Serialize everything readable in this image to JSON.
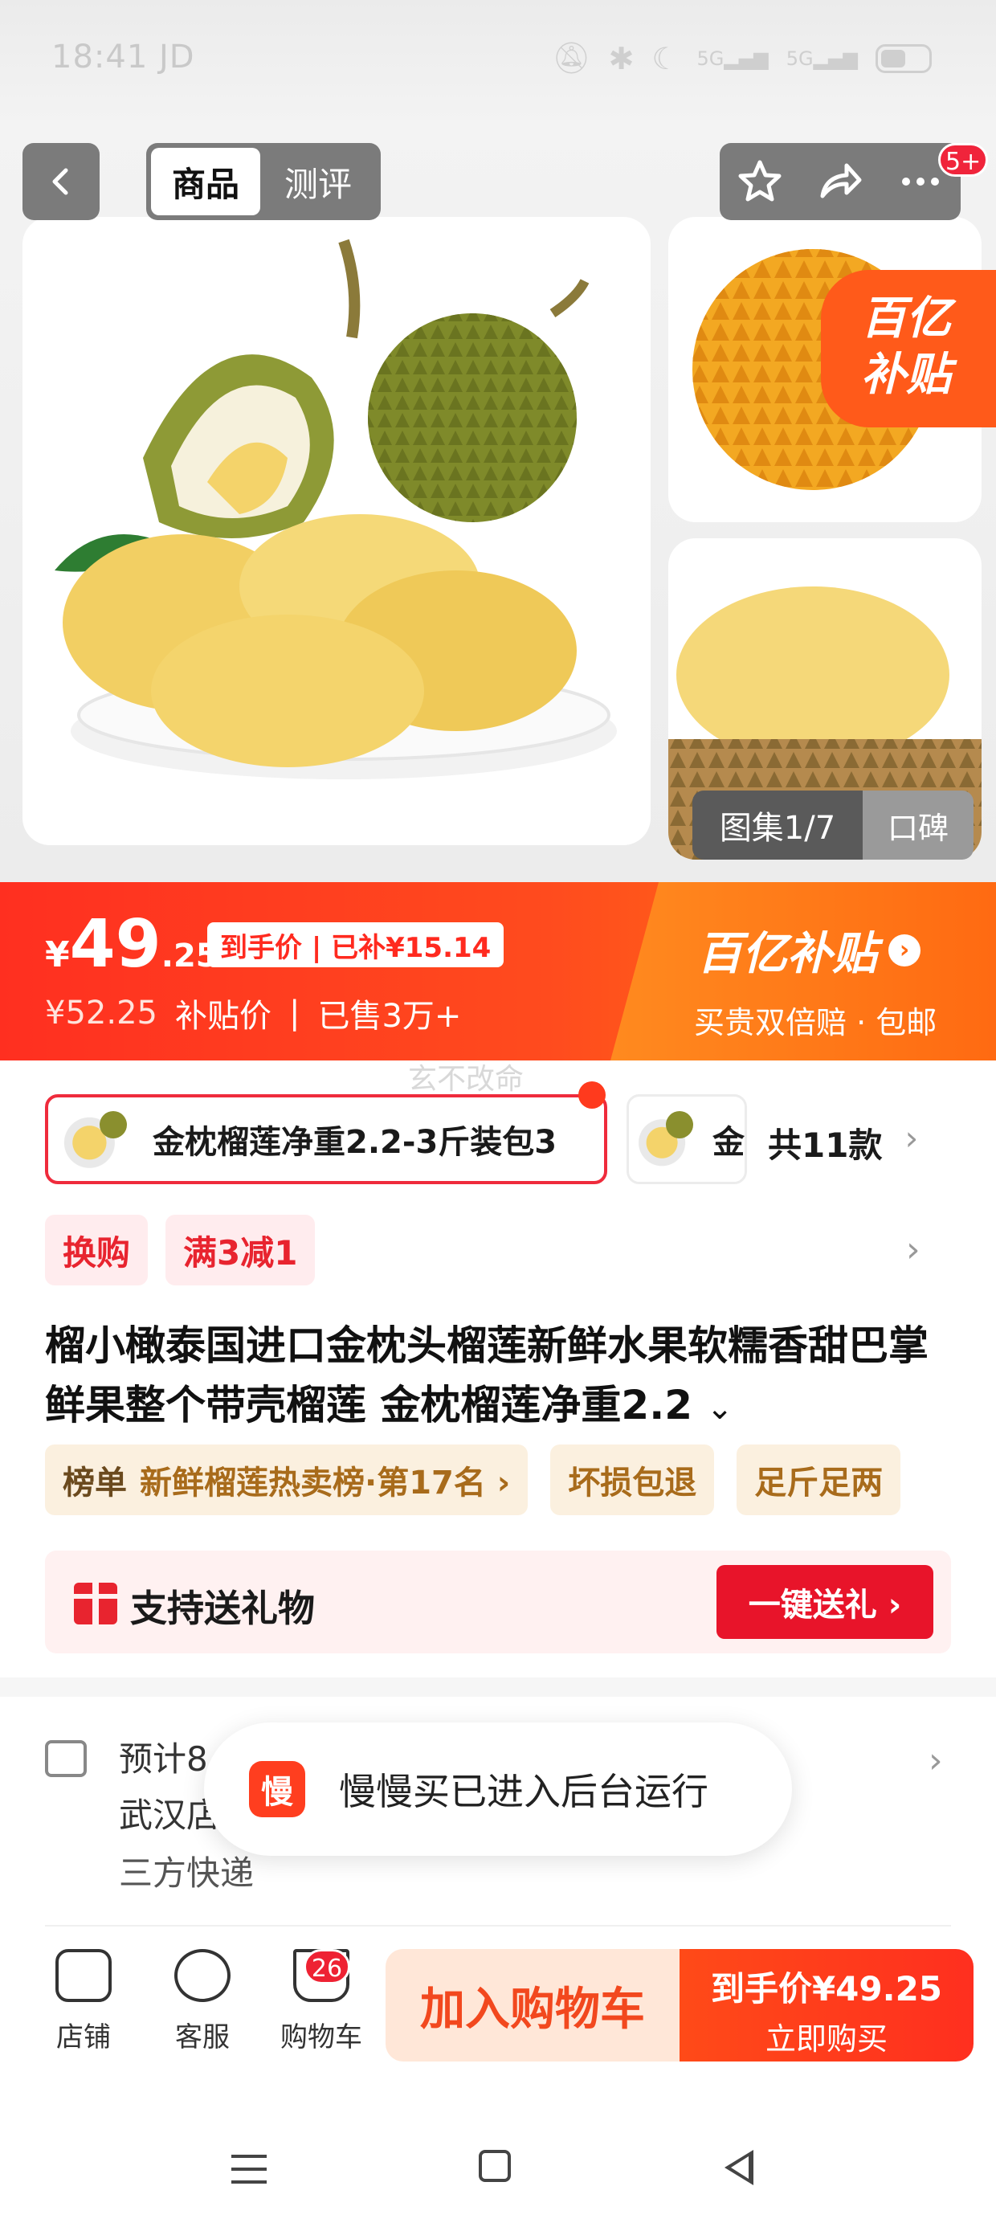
{
  "status_bar": {
    "time": "18:41",
    "carrier": "JD",
    "signal_1": "5G",
    "signal_2": "5G"
  },
  "nav": {
    "tab_goods": "商品",
    "tab_review": "测评",
    "notif_badge": "5+"
  },
  "gallery": {
    "subsidy_tag_l1": "百亿",
    "subsidy_tag_l2": "补贴",
    "album_counter": "图集1/7",
    "reputation_tab": "口碑"
  },
  "price": {
    "currency": "¥",
    "integer": "49",
    "decimal": ".25",
    "arrive_label": "到手价 | 已补¥15.14",
    "original": "¥52.25",
    "subsidy_label": "补贴价",
    "sold": "已售3万+",
    "brand": "百亿补贴",
    "brand_sub": "买贵双倍赔 · 包邮",
    "brand_arrow": "›"
  },
  "watermark": "玄不改命",
  "variants": {
    "selected_label": "金枕榴莲净重2.2-3斤装包3",
    "next_label_cut": "金",
    "total": "共11款",
    "chevron": "›"
  },
  "promo_tags": [
    "换购",
    "满3减1"
  ],
  "promo_chevron": "›",
  "product_title": "榴小橄泰国进口金枕头榴莲新鲜水果软糯香甜巴掌鲜果整个带壳榴莲 金枕榴莲净重2.2",
  "title_expand": "⌄",
  "ranking": {
    "key": "榜单",
    "value": "新鲜榴莲热卖榜·第17名 ›",
    "badge1": "坏损包退",
    "badge2": "足斤足两"
  },
  "gift": {
    "label": "支持送礼物",
    "button": "一键送礼 ›"
  },
  "shipping": {
    "line1": "预计8",
    "line2": "武汉店",
    "line3": "三方快递",
    "chevron": "›"
  },
  "toast": {
    "app_icon_text": "慢",
    "message": "慢慢买已进入后台运行"
  },
  "bottom_bar": {
    "store": "店铺",
    "service": "客服",
    "cart": "购物车",
    "cart_badge": "26",
    "add_to_cart": "加入购物车",
    "buy_price": "到手价¥49.25",
    "buy_now": "立即购买"
  },
  "colors": {
    "accent_red": "#e8242f",
    "subsidy_orange": "#ff6a12",
    "price_red": "#ff2f20"
  }
}
